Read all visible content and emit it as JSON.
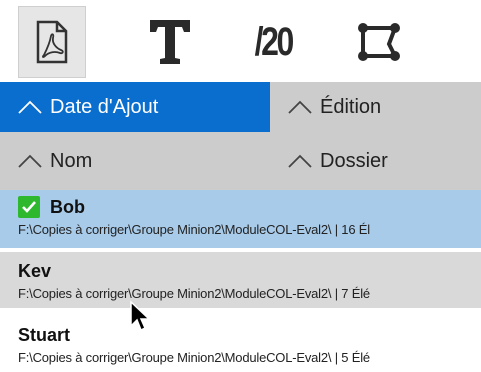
{
  "toolbar": {
    "tools": [
      {
        "icon": "pdf-icon",
        "active": true
      },
      {
        "icon": "text-tool-icon",
        "label": "T"
      },
      {
        "icon": "grade-icon",
        "label": "/20"
      },
      {
        "icon": "crop-shape-icon"
      }
    ]
  },
  "sort": {
    "date_added": "Date d'Ajout",
    "edition": "Édition",
    "name": "Nom",
    "folder": "Dossier"
  },
  "list": {
    "items": [
      {
        "name": "Bob",
        "path": "F:\\Copies à corriger\\Groupe Minion2\\ModuleCOL-Eval2\\ | 16 Él",
        "checked": true
      },
      {
        "name": "Kev",
        "path": "F:\\Copies à corriger\\Groupe Minion2\\ModuleCOL-Eval2\\ | 7 Élé"
      },
      {
        "name": "Stuart",
        "path": "F:\\Copies à corriger\\Groupe Minion2\\ModuleCOL-Eval2\\ | 5 Élé"
      }
    ]
  },
  "colors": {
    "accent": "#0a6ecf",
    "selected_row": "#a8cbea",
    "hover_row": "#d9d9d9",
    "check": "#2eb82e"
  }
}
